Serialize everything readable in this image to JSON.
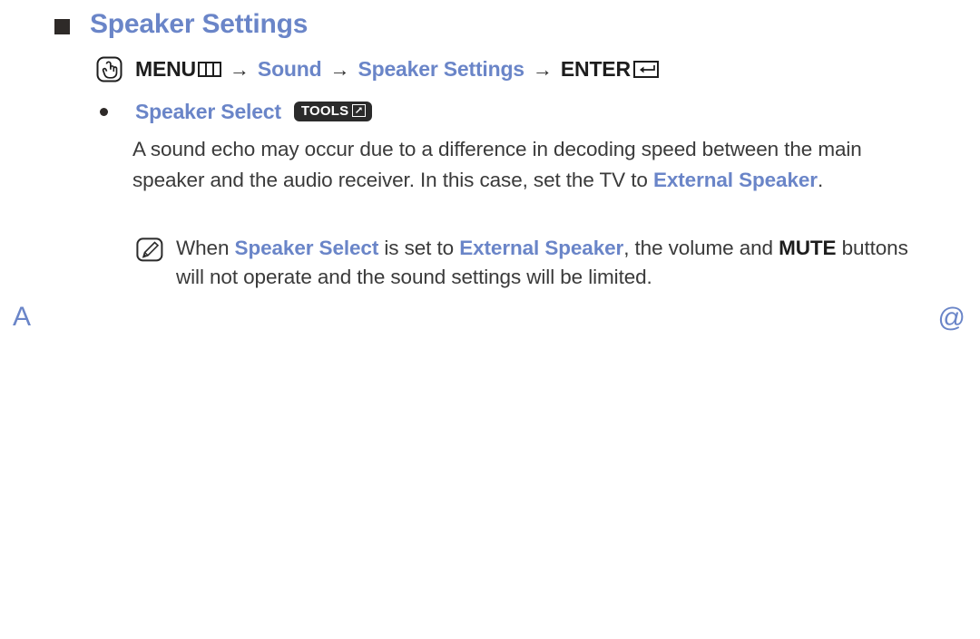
{
  "page": {
    "title": "Speaker Settings",
    "title_color": "#6a85c8",
    "body_color": "#3a3a3a",
    "background": "#ffffff"
  },
  "menu_path": {
    "icon": "hand-pointer-icon",
    "menu_label": "MENU",
    "menu_glyph": "menu-grid-icon",
    "arrow1": "→",
    "step1": "Sound",
    "arrow2": "→",
    "step2": "Speaker Settings",
    "arrow3": "→",
    "enter_label": "ENTER",
    "enter_glyph": "enter-key-icon"
  },
  "bullet": {
    "marker": "●",
    "label": "Speaker Select",
    "badge_label": "TOOLS",
    "badge_glyph": "tools-arrow-icon"
  },
  "paragraph": {
    "part1": "A sound echo may occur due to a difference in decoding speed between the main speaker and the audio receiver. In this case, set the TV to ",
    "highlight": "External Speaker",
    "part2": "."
  },
  "note": {
    "icon": "note-pen-icon",
    "part1": "When ",
    "highlight1": "Speaker Select",
    "part2": " is set to ",
    "highlight2": "External Speaker",
    "part3": ", the volume and ",
    "bold1": "MUTE",
    "part4": " buttons will not operate and the sound settings will be limited."
  },
  "footer": {
    "left_mark": "A",
    "right_mark": "@"
  }
}
